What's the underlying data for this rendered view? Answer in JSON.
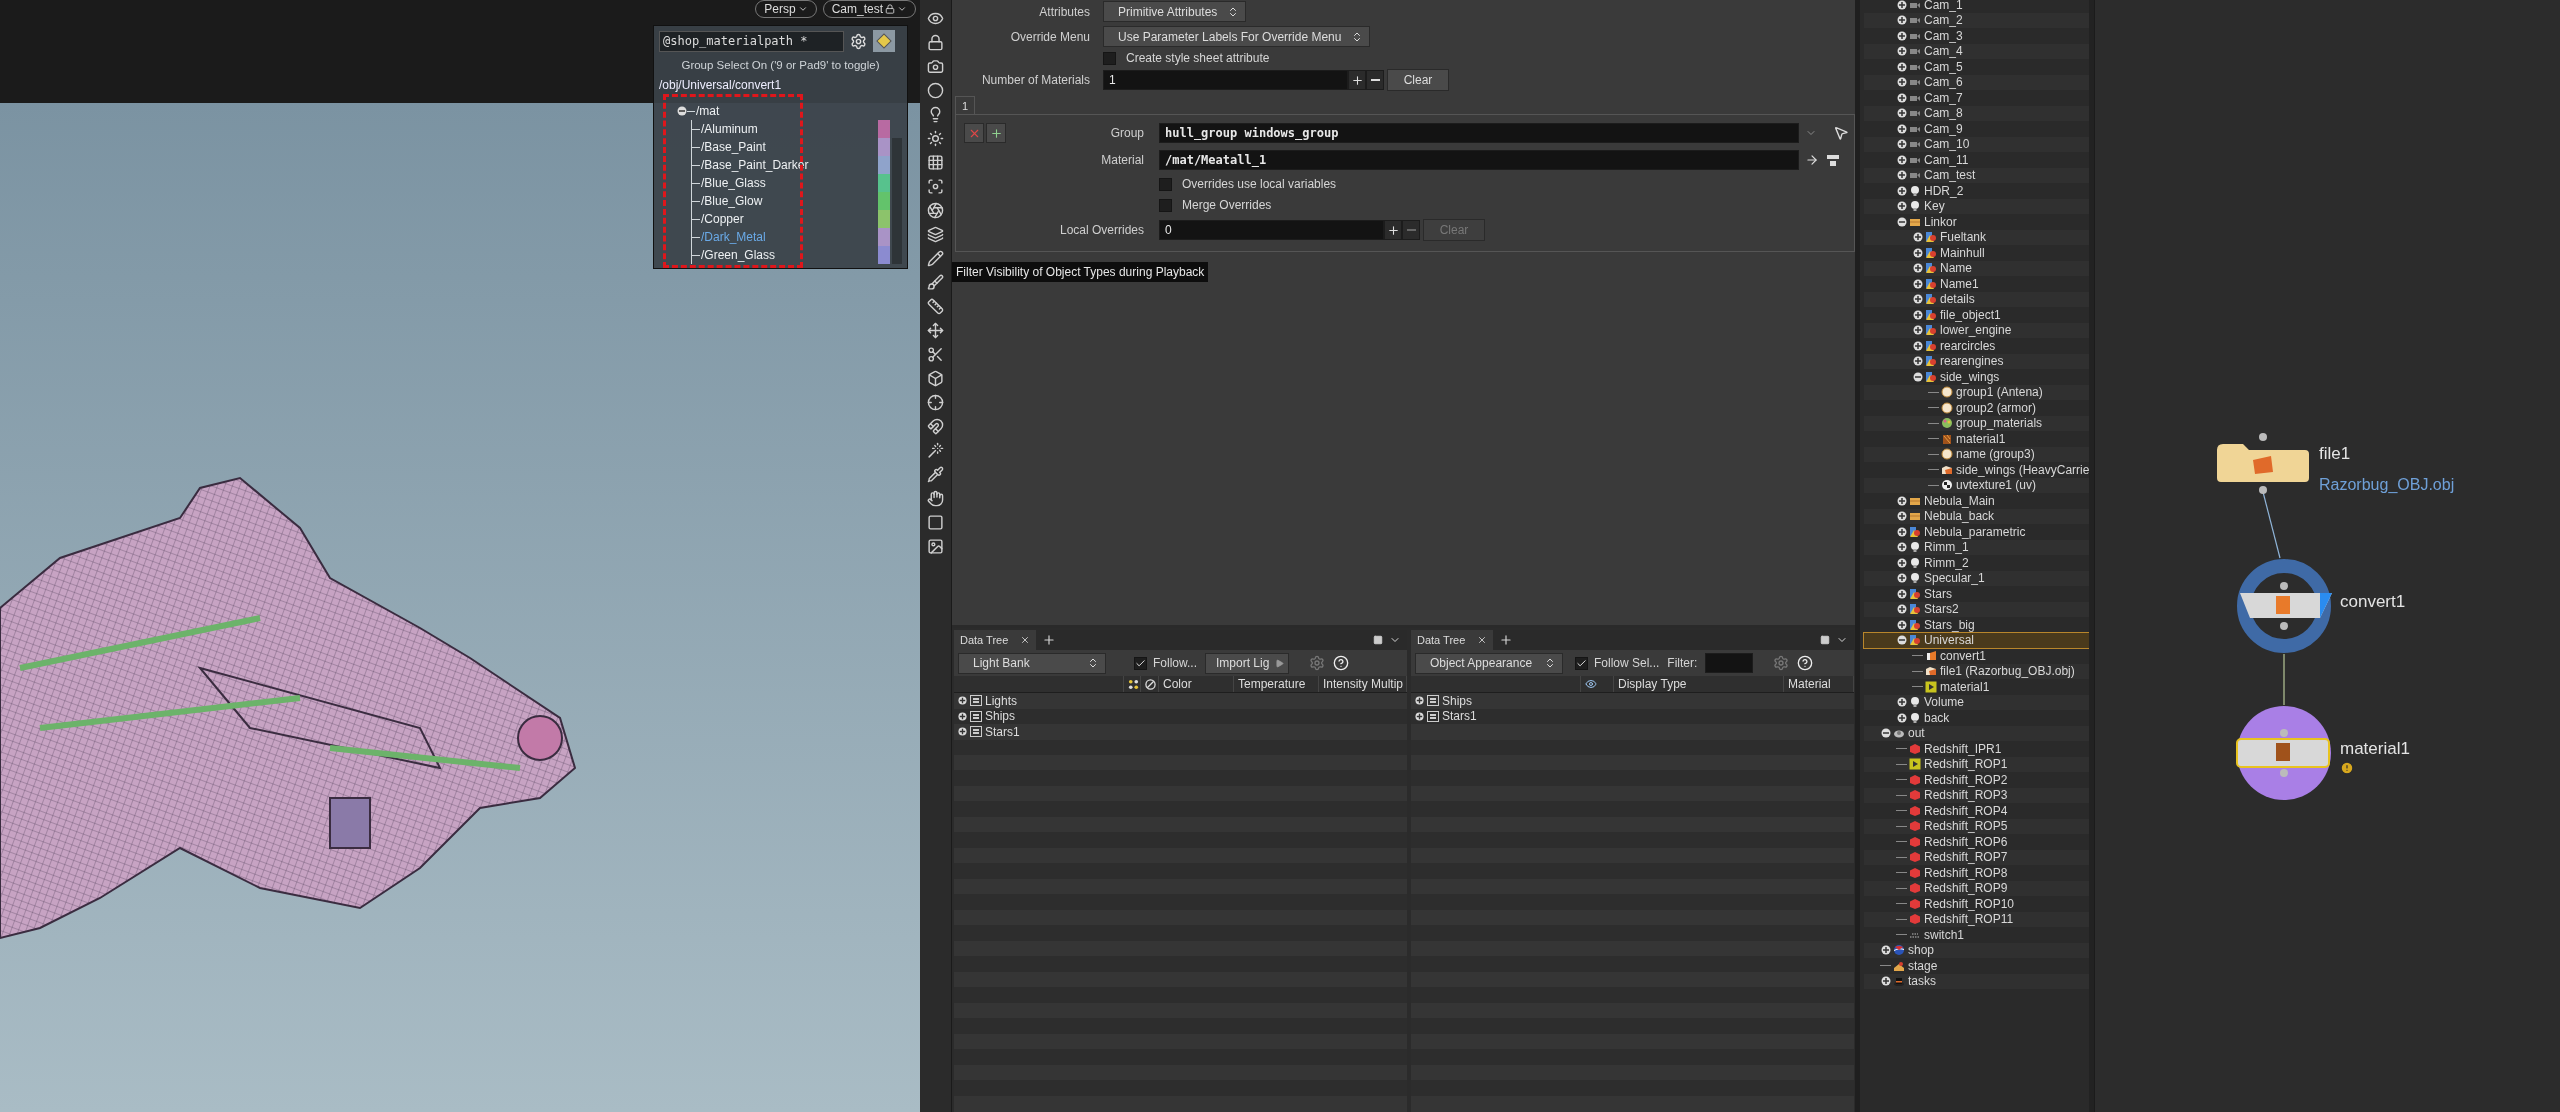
{
  "viewport": {
    "camera_buttons": [
      {
        "label": "Persp",
        "locked": false
      },
      {
        "label": "Cam_test",
        "locked": true
      }
    ],
    "material_popup": {
      "pattern": "@shop_materialpath *",
      "hint": "Group Select On ('9 or Pad9' to toggle)",
      "path": "/obj/Universal/convert1",
      "tree": {
        "label": "/mat",
        "expanded": true,
        "children": [
          {
            "label": "/Aluminum",
            "color": "#b86aa2",
            "selected": false
          },
          {
            "label": "/Base_Paint",
            "color": "#a993c6",
            "selected": false
          },
          {
            "label": "/Base_Paint_Darker",
            "color": "#8fa3cb",
            "selected": false
          },
          {
            "label": "/Blue_Glass",
            "color": "#57c28d",
            "selected": false
          },
          {
            "label": "/Blue_Glow",
            "color": "#63c36b",
            "selected": false
          },
          {
            "label": "/Copper",
            "color": "#8cc36b",
            "selected": false
          },
          {
            "label": "/Dark_Metal",
            "color": "#a993c6",
            "selected": true
          },
          {
            "label": "/Green_Glass",
            "color": "#8b8bd0",
            "selected": false
          }
        ]
      }
    }
  },
  "parameters": {
    "rows": [
      {
        "kind": "menu",
        "label": "Attributes",
        "value": "Primitive Attributes",
        "disabled": false
      },
      {
        "kind": "menu",
        "label": "Override Menu",
        "value": "Use Parameter Labels For Override Menu",
        "disabled": false
      },
      {
        "kind": "checkbox",
        "label": "Create style sheet attribute",
        "checked": false,
        "disabled": false
      },
      {
        "kind": "multiparm",
        "label": "Number of Materials",
        "value": "1",
        "clear": "Clear",
        "disabled": false
      }
    ],
    "tabs": [
      {
        "label": "1",
        "selected": true
      }
    ],
    "block": [
      {
        "kind": "group",
        "label": "Group",
        "value": "hull_group windows_group",
        "disabled": false
      },
      {
        "kind": "material",
        "label": "Material",
        "value": "/mat/Meatall_1",
        "disabled": false
      },
      {
        "kind": "checkbox",
        "label": "Overrides use local variables",
        "checked": false,
        "disabled": false
      },
      {
        "kind": "checkbox",
        "label": "Merge Overrides",
        "checked": false,
        "disabled": false
      },
      {
        "kind": "multiparm",
        "label": "Local Overrides",
        "value": "0",
        "clear": "Clear",
        "disabled": true
      }
    ]
  },
  "tooltip": "Filter Visibility of Object Types during Playback",
  "data_trees": [
    {
      "kind": "light_bank",
      "tab": "Data Tree",
      "view": "Light Bank",
      "follow": {
        "label": "Follow...",
        "checked": true
      },
      "button": "Import Lig",
      "columns": [
        "Color",
        "Temperature",
        "Intensity Multip"
      ],
      "rows": [
        "Lights",
        "Ships",
        "Stars1"
      ]
    },
    {
      "kind": "object_appearance",
      "tab": "Data Tree",
      "view": "Object Appearance",
      "follow": {
        "label": "Follow Sel...",
        "checked": true
      },
      "filter": "Filter:",
      "columns": [
        "Display Type",
        "Material"
      ],
      "rows": [
        "Ships",
        "Stars1"
      ]
    }
  ],
  "outliner": {
    "obj_children": [
      {
        "label": "Cam_1",
        "kind": "camera",
        "expanded": false,
        "selected": false
      },
      {
        "label": "Cam_2",
        "kind": "camera",
        "expanded": false,
        "selected": false
      },
      {
        "label": "Cam_3",
        "kind": "camera",
        "expanded": false,
        "selected": false
      },
      {
        "label": "Cam_4",
        "kind": "camera",
        "expanded": false,
        "selected": false
      },
      {
        "label": "Cam_5",
        "kind": "camera",
        "expanded": false,
        "selected": false
      },
      {
        "label": "Cam_6",
        "kind": "camera",
        "expanded": false,
        "selected": false
      },
      {
        "label": "Cam_7",
        "kind": "camera",
        "expanded": false,
        "selected": false
      },
      {
        "label": "Cam_8",
        "kind": "camera",
        "expanded": false,
        "selected": false
      },
      {
        "label": "Cam_9",
        "kind": "camera",
        "expanded": false,
        "selected": false
      },
      {
        "label": "Cam_10",
        "kind": "camera",
        "expanded": false,
        "selected": false
      },
      {
        "label": "Cam_11",
        "kind": "camera",
        "expanded": false,
        "selected": false
      },
      {
        "label": "Cam_test",
        "kind": "camera",
        "expanded": false,
        "selected": false
      },
      {
        "label": "HDR_2",
        "kind": "light",
        "expanded": false,
        "selected": false
      },
      {
        "label": "Key",
        "kind": "light",
        "expanded": false,
        "selected": false
      },
      {
        "label": "Linkor",
        "kind": "subnet",
        "expanded": true,
        "selected": false,
        "children": [
          {
            "label": "Fueltank",
            "kind": "geo",
            "expanded": false,
            "selected": false
          },
          {
            "label": "Mainhull",
            "kind": "geo",
            "expanded": false,
            "selected": false
          },
          {
            "label": "Name",
            "kind": "geo",
            "expanded": false,
            "selected": false
          },
          {
            "label": "Name1",
            "kind": "geo",
            "expanded": false,
            "selected": false
          },
          {
            "label": "details",
            "kind": "geo",
            "expanded": false,
            "selected": false
          },
          {
            "label": "file_object1",
            "kind": "geo",
            "expanded": false,
            "selected": false
          },
          {
            "label": "lower_engine",
            "kind": "geo",
            "expanded": false,
            "selected": false
          },
          {
            "label": "rearcircles",
            "kind": "geo",
            "expanded": false,
            "selected": false
          },
          {
            "label": "rearengines",
            "kind": "geo",
            "expanded": false,
            "selected": false
          },
          {
            "label": "side_wings",
            "kind": "geo",
            "expanded": true,
            "selected": false,
            "children": [
              {
                "label": "group1 (Antena)",
                "kind": "group",
                "selected": false
              },
              {
                "label": "group2 (armor)",
                "kind": "group",
                "selected": false
              },
              {
                "label": "group_materials",
                "kind": "palette",
                "selected": false
              },
              {
                "label": "material1",
                "kind": "material",
                "selected": false
              },
              {
                "label": "name (group3)",
                "kind": "group",
                "selected": false
              },
              {
                "label": "side_wings (HeavyCarrie",
                "kind": "file",
                "selected": false
              },
              {
                "label": "uvtexture1 (uv)",
                "kind": "uv",
                "selected": false
              }
            ]
          }
        ]
      },
      {
        "label": "Nebula_Main",
        "kind": "subnet",
        "expanded": false,
        "selected": false
      },
      {
        "label": "Nebula_back",
        "kind": "subnet",
        "expanded": false,
        "selected": false
      },
      {
        "label": "Nebula_parametric",
        "kind": "geo",
        "expanded": false,
        "selected": false
      },
      {
        "label": "Rimm_1",
        "kind": "light",
        "expanded": false,
        "selected": false
      },
      {
        "label": "Rimm_2",
        "kind": "light",
        "expanded": false,
        "selected": false
      },
      {
        "label": "Specular_1",
        "kind": "light",
        "expanded": false,
        "selected": false
      },
      {
        "label": "Stars",
        "kind": "geo",
        "expanded": false,
        "selected": false
      },
      {
        "label": "Stars2",
        "kind": "geo",
        "expanded": false,
        "selected": false
      },
      {
        "label": "Stars_big",
        "kind": "geo",
        "expanded": false,
        "selected": false
      },
      {
        "label": "Universal",
        "kind": "geo",
        "expanded": true,
        "selected": true,
        "children": [
          {
            "label": "convert1",
            "kind": "convert",
            "selected": false
          },
          {
            "label": "file1 (Razorbug_OBJ.obj)",
            "kind": "file",
            "selected": false
          },
          {
            "label": "material1",
            "kind": "flag",
            "selected": false
          }
        ]
      },
      {
        "label": "Volume",
        "kind": "light",
        "expanded": false,
        "selected": false
      },
      {
        "label": "back",
        "kind": "light",
        "expanded": false,
        "selected": false
      }
    ],
    "items": [
      {
        "label": "out",
        "kind": "out",
        "expanded": true,
        "selected": false,
        "children": [
          {
            "label": "Redshift_IPR1",
            "kind": "rop",
            "selected": false
          },
          {
            "label": "Redshift_ROP1",
            "kind": "flag",
            "selected": false
          },
          {
            "label": "Redshift_ROP2",
            "kind": "rop",
            "selected": false
          },
          {
            "label": "Redshift_ROP3",
            "kind": "rop",
            "selected": false
          },
          {
            "label": "Redshift_ROP4",
            "kind": "rop",
            "selected": false
          },
          {
            "label": "Redshift_ROP5",
            "kind": "rop",
            "selected": false
          },
          {
            "label": "Redshift_ROP6",
            "kind": "rop",
            "selected": false
          },
          {
            "label": "Redshift_ROP7",
            "kind": "rop",
            "selected": false
          },
          {
            "label": "Redshift_ROP8",
            "kind": "rop",
            "selected": false
          },
          {
            "label": "Redshift_ROP9",
            "kind": "rop",
            "selected": false
          },
          {
            "label": "Redshift_ROP10",
            "kind": "rop",
            "selected": false
          },
          {
            "label": "Redshift_ROP11",
            "kind": "rop",
            "selected": false
          },
          {
            "label": "switch1",
            "kind": "switch",
            "selected": false
          }
        ]
      },
      {
        "label": "shop",
        "kind": "shop",
        "expanded": false,
        "selected": false
      },
      {
        "label": "stage",
        "kind": "stage",
        "selected": false
      },
      {
        "label": "tasks",
        "kind": "tasks",
        "expanded": false,
        "selected": false
      }
    ]
  },
  "network": {
    "nodes": [
      {
        "name": "file1",
        "kind": "file",
        "subtitle": "Razorbug_OBJ.obj",
        "display": false,
        "selected": false,
        "warning": false
      },
      {
        "name": "convert1",
        "kind": "convert",
        "color": "#3f6aa6",
        "display": true,
        "selected": false,
        "warning": false
      },
      {
        "name": "material1",
        "kind": "material",
        "color": "#a97fe6",
        "display": false,
        "selected": true,
        "warning": true
      }
    ]
  }
}
